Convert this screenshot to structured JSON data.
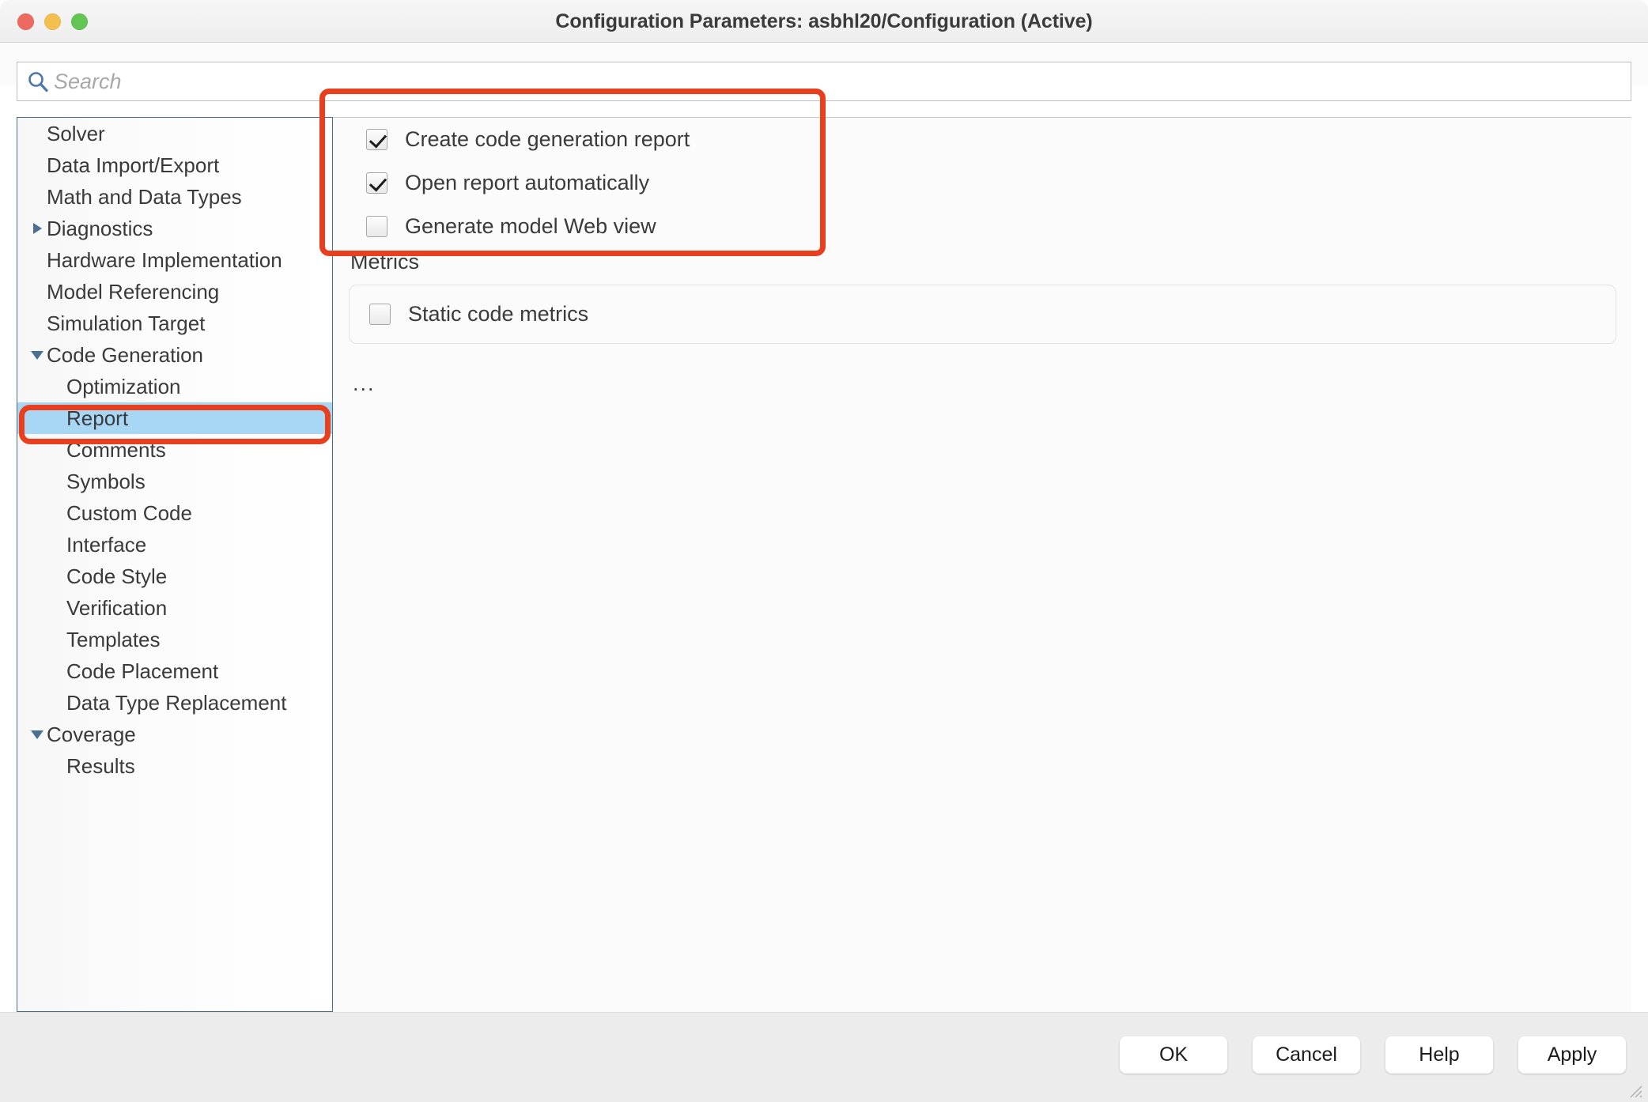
{
  "window": {
    "title": "Configuration Parameters: asbhl20/Configuration (Active)",
    "traffic_lights": {
      "close_color": "#ec6a5f",
      "minimize_color": "#f3bf4f",
      "maximize_color": "#62c554"
    }
  },
  "search": {
    "placeholder": "Search",
    "value": ""
  },
  "sidebar": {
    "items": [
      {
        "label": "Solver",
        "level": 0,
        "twisty": "none",
        "selected": false
      },
      {
        "label": "Data Import/Export",
        "level": 0,
        "twisty": "none",
        "selected": false
      },
      {
        "label": "Math and Data Types",
        "level": 0,
        "twisty": "none",
        "selected": false
      },
      {
        "label": "Diagnostics",
        "level": 0,
        "twisty": "right",
        "selected": false
      },
      {
        "label": "Hardware Implementation",
        "level": 0,
        "twisty": "none",
        "selected": false
      },
      {
        "label": "Model Referencing",
        "level": 0,
        "twisty": "none",
        "selected": false
      },
      {
        "label": "Simulation Target",
        "level": 0,
        "twisty": "none",
        "selected": false
      },
      {
        "label": "Code Generation",
        "level": 0,
        "twisty": "down",
        "selected": false
      },
      {
        "label": "Optimization",
        "level": 1,
        "twisty": "none",
        "selected": false
      },
      {
        "label": "Report",
        "level": 1,
        "twisty": "none",
        "selected": true
      },
      {
        "label": "Comments",
        "level": 1,
        "twisty": "none",
        "selected": false
      },
      {
        "label": "Symbols",
        "level": 1,
        "twisty": "none",
        "selected": false
      },
      {
        "label": "Custom Code",
        "level": 1,
        "twisty": "none",
        "selected": false
      },
      {
        "label": "Interface",
        "level": 1,
        "twisty": "none",
        "selected": false
      },
      {
        "label": "Code Style",
        "level": 1,
        "twisty": "none",
        "selected": false
      },
      {
        "label": "Verification",
        "level": 1,
        "twisty": "none",
        "selected": false
      },
      {
        "label": "Templates",
        "level": 1,
        "twisty": "none",
        "selected": false
      },
      {
        "label": "Code Placement",
        "level": 1,
        "twisty": "none",
        "selected": false
      },
      {
        "label": "Data Type Replacement",
        "level": 1,
        "twisty": "none",
        "selected": false
      },
      {
        "label": "Coverage",
        "level": 0,
        "twisty": "down",
        "selected": false
      },
      {
        "label": "Results",
        "level": 1,
        "twisty": "none",
        "selected": false
      }
    ],
    "selected_item": "Report"
  },
  "main": {
    "report_options": [
      {
        "label": "Create code generation report",
        "checked": true
      },
      {
        "label": "Open report automatically",
        "checked": true
      },
      {
        "label": "Generate model Web view",
        "checked": false
      }
    ],
    "metrics": {
      "title": "Metrics",
      "options": [
        {
          "label": "Static code metrics",
          "checked": false
        }
      ]
    },
    "ellipsis": "..."
  },
  "annotations": {
    "highlight_color": "#e8401f",
    "boxes": [
      {
        "name": "report-checkbox-group"
      },
      {
        "name": "report-tree-item"
      }
    ]
  },
  "footer": {
    "buttons": [
      {
        "label": "OK"
      },
      {
        "label": "Cancel"
      },
      {
        "label": "Help"
      },
      {
        "label": "Apply"
      }
    ]
  }
}
